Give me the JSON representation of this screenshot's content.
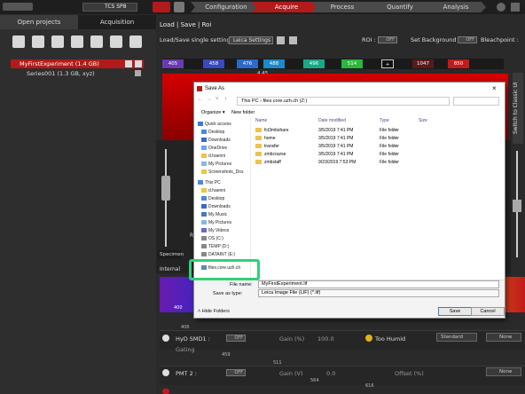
{
  "app": {
    "system": "TCS SP8",
    "workflow": [
      "Configuration",
      "Acquire",
      "Process",
      "Quantify",
      "Analysis"
    ],
    "active_step": "Acquire"
  },
  "left_tabs": [
    "Open projects",
    "Acquisition"
  ],
  "projects": {
    "experiment": "MyFirstExperiment  (1.4 GB)",
    "series": "Series001  (1.3 GB, xyz)"
  },
  "right": {
    "title": "Load | Save | Roi",
    "load_save_label": "Load/Save single setting :",
    "settings_select": "Leica Settings",
    "roi_label": "ROI :",
    "roi_state": "OFF",
    "background_label": "Set Background :",
    "background_state": "OFF",
    "bleach_label": "Bleachpoint :",
    "side_button": "Switch to Classic UI",
    "value_445": "4.45",
    "specimen": "Specimen",
    "internal": "Internal",
    "ruler": [
      "400",
      "500"
    ],
    "r_label": "R"
  },
  "laser_lines": [
    "405",
    "458",
    "476",
    "488",
    "496",
    "514",
    "+",
    "1047",
    "850"
  ],
  "detectors": [
    {
      "name": "HyD SMD1 :",
      "state": "OFF",
      "gain_label": "Gain (%)",
      "gain_value": "100.0",
      "humid": "Too Humid",
      "mode": "Standard",
      "none": "None",
      "gating": "Gating",
      "tick": "406",
      "tick2": "459"
    },
    {
      "name": "PMT 2 :",
      "state": "OFF",
      "gain_label": "Gain (V)",
      "gain_value": "0.0",
      "offset": "Offset (%)",
      "none": "None",
      "tick": "511",
      "tick2": "564"
    },
    {
      "tick": "616"
    }
  ],
  "dialog": {
    "title": "Save As",
    "path": [
      "This PC",
      "files.core.uzh.ch (Z:)"
    ],
    "organize": "Organize ▾",
    "new_folder": "New folder",
    "columns": {
      "name": "Name",
      "date": "Date modified",
      "type": "Type",
      "size": "Size"
    },
    "nav": [
      {
        "label": "Quick access"
      },
      {
        "label": "Desktop"
      },
      {
        "label": "Downloads"
      },
      {
        "label": "OneDrive"
      },
      {
        "label": "d.haenni"
      },
      {
        "label": "My Pictures"
      },
      {
        "label": "Screenshots_Dox"
      },
      {
        "label": "This PC"
      },
      {
        "label": "d.haenni"
      },
      {
        "label": "Desktop"
      },
      {
        "label": "Downloads"
      },
      {
        "label": "My Music"
      },
      {
        "label": "My Pictures"
      },
      {
        "label": "My Videos"
      },
      {
        "label": "OS (C:)"
      },
      {
        "label": "TEMP (D:)"
      },
      {
        "label": "DATAINT (E:)"
      },
      {
        "label": "files.core.uzh.ch"
      }
    ],
    "files": [
      {
        "name": "fct3mbshare",
        "date": "3/5/2019 7:41 PM",
        "type": "File folder"
      },
      {
        "name": "home",
        "date": "3/5/2019 7:41 PM",
        "type": "File folder"
      },
      {
        "name": "transfer",
        "date": "3/5/2019 7:41 PM",
        "type": "File folder"
      },
      {
        "name": "zmbcourse",
        "date": "3/5/2019 7:41 PM",
        "type": "File folder"
      },
      {
        "name": "zmbstaff",
        "date": "9/23/2019 7:53 PM",
        "type": "File folder"
      }
    ],
    "file_name_label": "File name:",
    "file_name": "MyFirstExperiment.lif",
    "save_type_label": "Save as type:",
    "save_type": "Leica Image File (LIF) (*.lif)",
    "hide_folders": "Hide Folders",
    "save": "Save",
    "cancel": "Cancel"
  },
  "colors": {
    "accent": "#b31a1a",
    "highlight": "#2fd178"
  }
}
